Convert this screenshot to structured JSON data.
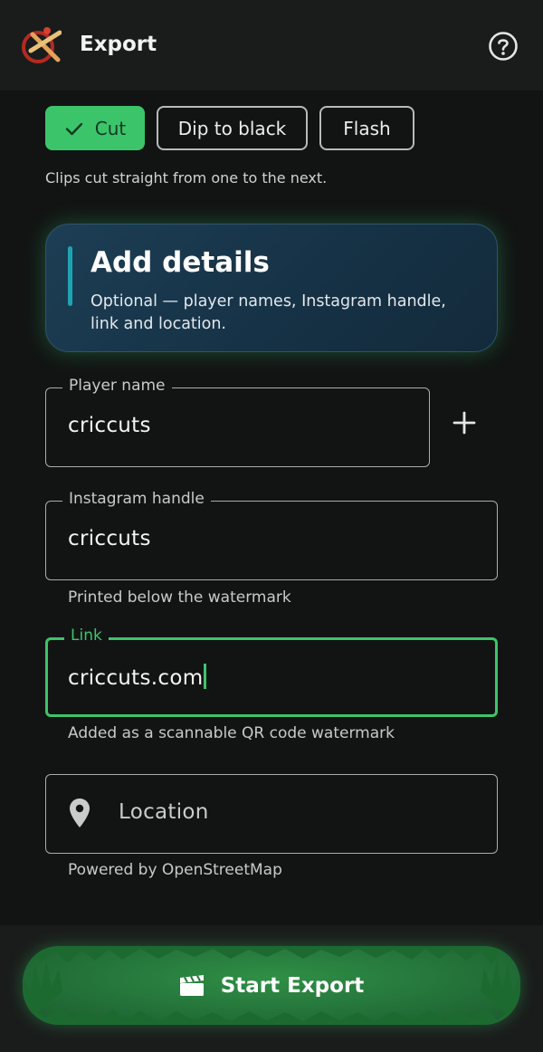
{
  "header": {
    "title": "Export",
    "logo_icon": "criccuts-logo-icon",
    "help_icon": "help-circle-icon"
  },
  "transitions": {
    "options": [
      {
        "label": "Cut",
        "selected": true
      },
      {
        "label": "Dip to black",
        "selected": false
      },
      {
        "label": "Flash",
        "selected": false
      }
    ],
    "description": "Clips cut straight from one to the next."
  },
  "details_card": {
    "title": "Add details",
    "subtitle": "Optional — player names, Instagram handle, link and location."
  },
  "form": {
    "player_name": {
      "label": "Player name",
      "value": "criccuts",
      "add_icon": "plus-icon"
    },
    "instagram": {
      "label": "Instagram handle",
      "value": "criccuts",
      "helper": "Printed below the watermark"
    },
    "link": {
      "label": "Link",
      "value": "criccuts.com",
      "helper": "Added as a scannable QR code watermark"
    },
    "location": {
      "placeholder": "Location",
      "icon": "location-pin-icon",
      "helper": "Powered by OpenStreetMap"
    }
  },
  "export_button": {
    "label": "Start Export",
    "icon": "clapperboard-icon"
  },
  "colors": {
    "accent_green": "#3cc46b",
    "background": "#121413",
    "card_blue": "#1d3e55"
  }
}
